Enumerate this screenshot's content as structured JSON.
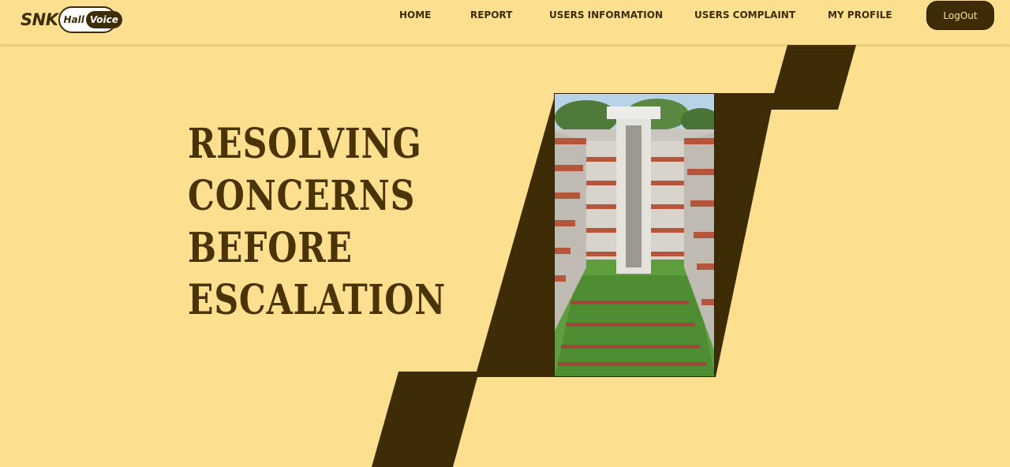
{
  "logo": {
    "snk": "SNK",
    "hall": "Hall",
    "voice": "Voice"
  },
  "nav": {
    "home": "HOME",
    "report": "REPORT",
    "users_information": "USERS INFORMATION",
    "users_complaint": "USERS COMPLAINT",
    "my_profile": "MY PROFILE",
    "logout": "LogOut"
  },
  "hero": {
    "line1": "RESOLVING",
    "line2": "CONCERNS",
    "line3": "BEFORE",
    "line4": "ESCALATION"
  },
  "colors": {
    "background": "#fde08f",
    "brand_dark": "#3d2c05",
    "text": "#4a3305"
  }
}
